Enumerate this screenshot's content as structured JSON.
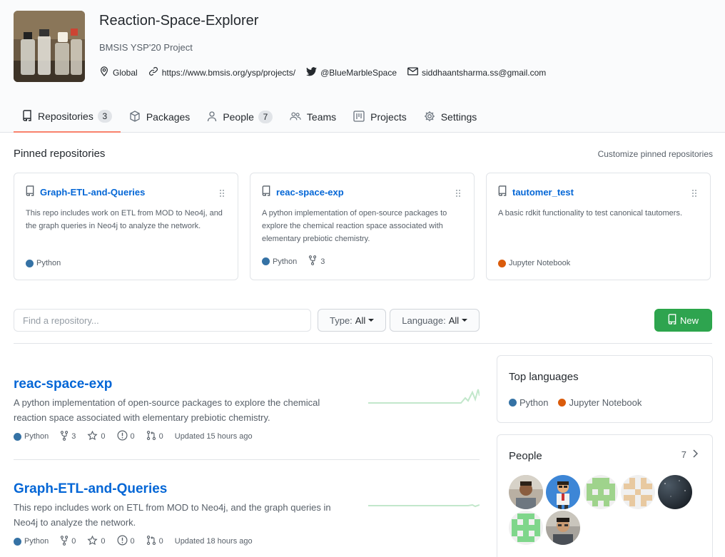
{
  "org": {
    "name": "Reaction-Space-Explorer",
    "description": "BMSIS YSP'20 Project",
    "location": "Global",
    "website": "https://www.bmsis.org/ysp/projects/",
    "twitter": "@BlueMarbleSpace",
    "email": "siddhaantsharma.ss@gmail.com"
  },
  "tabs": [
    {
      "label": "Repositories",
      "icon": "repo-icon",
      "count": "3",
      "selected": true
    },
    {
      "label": "Packages",
      "icon": "package-icon"
    },
    {
      "label": "People",
      "icon": "person-icon",
      "count": "7"
    },
    {
      "label": "Teams",
      "icon": "people-icon"
    },
    {
      "label": "Projects",
      "icon": "project-icon"
    },
    {
      "label": "Settings",
      "icon": "gear-icon"
    }
  ],
  "pinned": {
    "title": "Pinned repositories",
    "customize": "Customize pinned repositories",
    "items": [
      {
        "name": "Graph-ETL-and-Queries",
        "description": "This repo includes work on ETL from MOD to Neo4j, and the graph queries in Neo4j to analyze the network.",
        "language": "Python",
        "color": "#3572A5"
      },
      {
        "name": "reac-space-exp",
        "description": "A python implementation of open-source packages to explore the chemical reaction space associated with elementary prebiotic chemistry.",
        "language": "Python",
        "color": "#3572A5",
        "forks": "3"
      },
      {
        "name": "tautomer_test",
        "description": "A basic rdkit functionality to test canonical tautomers.",
        "language": "Jupyter Notebook",
        "color": "#DA5B0B"
      }
    ]
  },
  "filters": {
    "search_placeholder": "Find a repository...",
    "type_label": "Type:",
    "type_value": "All",
    "language_label": "Language:",
    "language_value": "All",
    "new_label": "New"
  },
  "repos": [
    {
      "name": "reac-space-exp",
      "description": "A python implementation of open-source packages to explore the chemical reaction space associated with elementary prebiotic chemistry.",
      "language": "Python",
      "color": "#3572A5",
      "forks": "3",
      "stars": "0",
      "issues": "0",
      "pulls": "0",
      "updated": "Updated 15 hours ago"
    },
    {
      "name": "Graph-ETL-and-Queries",
      "description": "This repo includes work on ETL from MOD to Neo4j, and the graph queries in Neo4j to analyze the network.",
      "language": "Python",
      "color": "#3572A5",
      "forks": "0",
      "stars": "0",
      "issues": "0",
      "pulls": "0",
      "updated": "Updated 18 hours ago"
    }
  ],
  "sidebar": {
    "languages_title": "Top languages",
    "languages": [
      {
        "name": "Python",
        "color": "#3572A5"
      },
      {
        "name": "Jupyter Notebook",
        "color": "#DA5B0B"
      }
    ],
    "people_title": "People",
    "people_count": "7"
  },
  "colors": {
    "accent": "#0366d6",
    "tab_underline": "#f9826c",
    "new_button": "#2ea44f",
    "sparkline": "#c2e7cb"
  }
}
